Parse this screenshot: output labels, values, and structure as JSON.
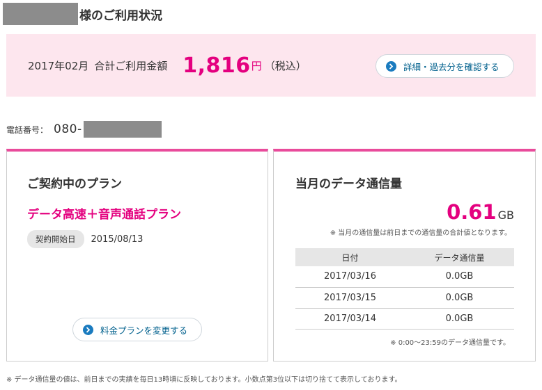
{
  "header": {
    "name_suffix": "様のご利用状況"
  },
  "summary": {
    "month": "2017年02月",
    "label": "合計ご利用金額",
    "amount": "1,816",
    "unit": "円",
    "tax": "（税込）",
    "detail_button": "詳細・過去分を確認する"
  },
  "phone": {
    "label": "電話番号：",
    "prefix": "080-"
  },
  "plan_card": {
    "title": "ご契約中のプラン",
    "plan_name": "データ高速＋音声通話プラン",
    "contract_label": "契約開始日",
    "contract_date": "2015/08/13",
    "change_button": "料金プランを変更する"
  },
  "usage_card": {
    "title": "当月のデータ通信量",
    "total_value": "0.61",
    "total_unit": "GB",
    "note": "※ 当月の通信量は前日までの通信量の合計値となります。",
    "table": {
      "headers": [
        "日付",
        "データ通信量"
      ],
      "rows": [
        [
          "2017/03/16",
          "0.0GB"
        ],
        [
          "2017/03/15",
          "0.0GB"
        ],
        [
          "2017/03/14",
          "0.0GB"
        ]
      ]
    },
    "footnote": "※ 0:00～23:59のデータ通信量です。"
  },
  "footer": {
    "note": "※ データ通信量の値は、前日までの実績を毎日13時頃に反映しております。小数点第3位以下は切り捨てて表示しております。"
  },
  "colors": {
    "accent": "#e4007f",
    "pink_background": "#fde6ee",
    "link_blue": "#1a7bbf",
    "card_top_border": "#e94b9b"
  }
}
